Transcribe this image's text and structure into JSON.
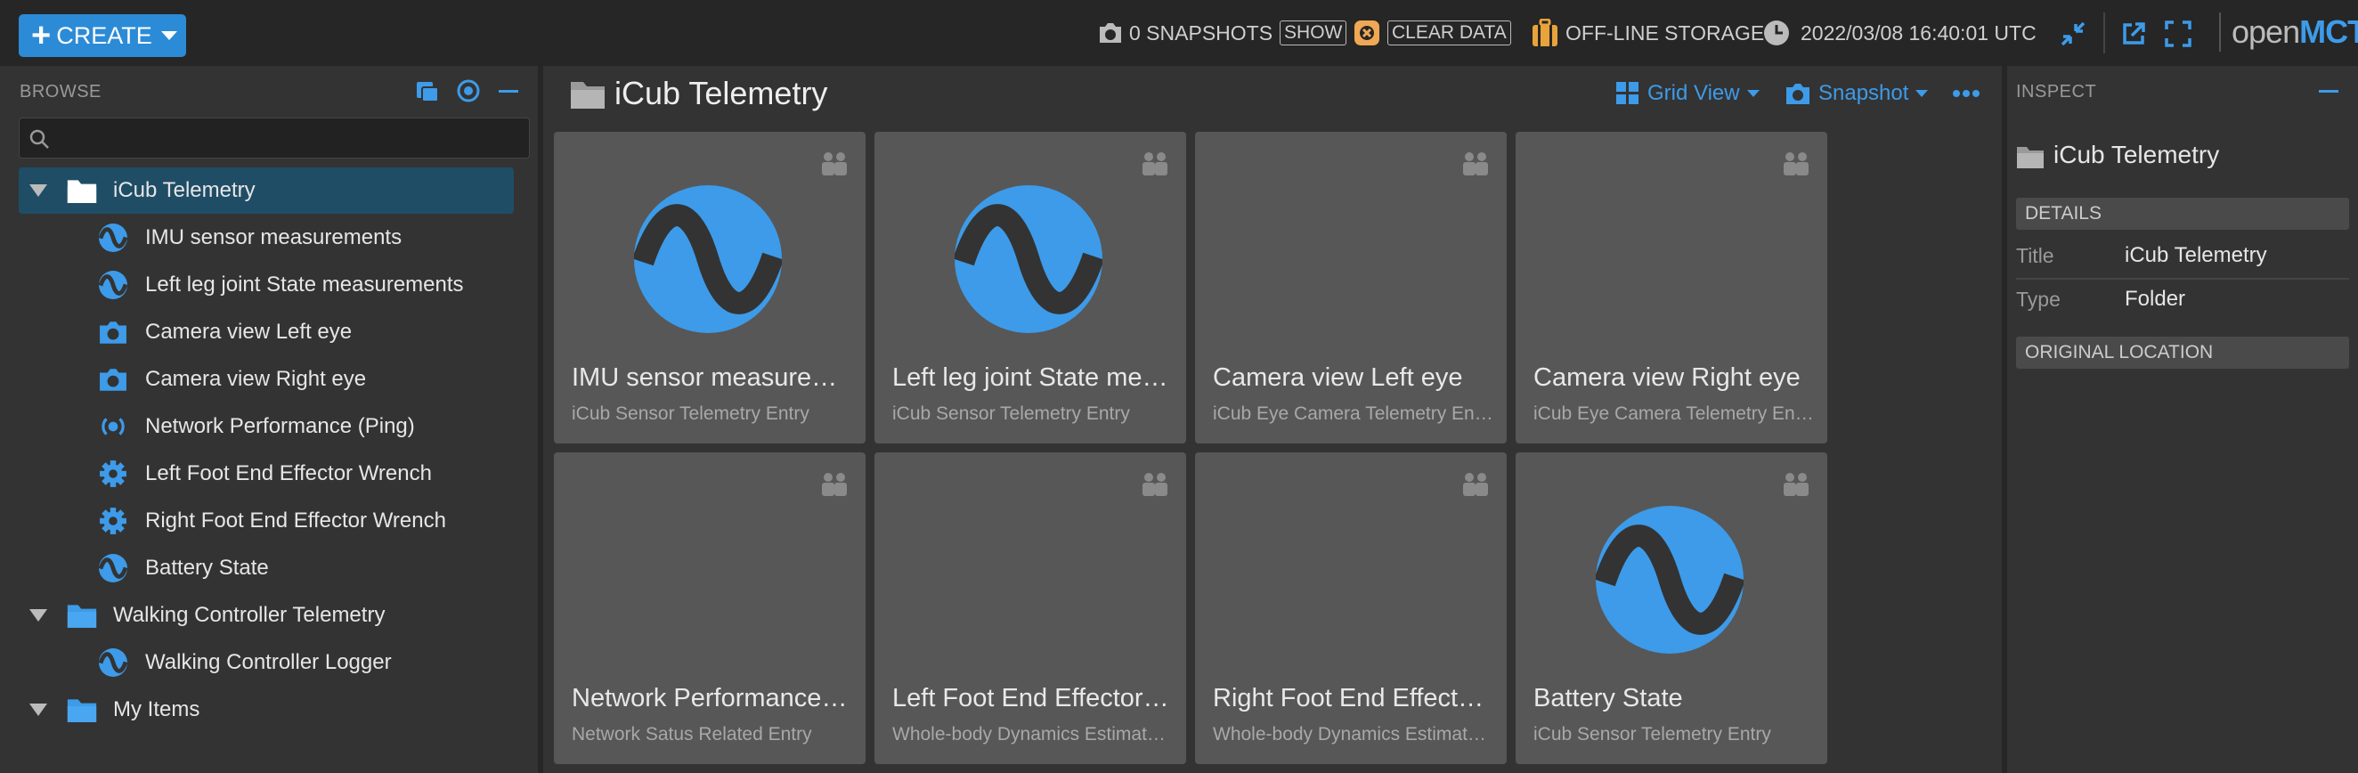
{
  "topbar": {
    "create_label": "CREATE",
    "snapshots_label": "0 SNAPSHOTS",
    "show_label": "SHOW",
    "clear_data_label": "CLEAR DATA",
    "offline_storage_label": "OFF-LINE STORAGE",
    "clock": "2022/03/08 16:40:01 UTC",
    "brand_open": "open",
    "brand_mct": "MCT"
  },
  "browse": {
    "label": "BROWSE",
    "search_placeholder": "",
    "tree": [
      {
        "label": "iCub Telemetry",
        "icon": "folder-icon",
        "level": 0,
        "expanded": true,
        "selected": true
      },
      {
        "label": "IMU sensor measurements",
        "icon": "telemetry-icon",
        "level": 1
      },
      {
        "label": "Left leg joint State measurements",
        "icon": "telemetry-icon",
        "level": 1
      },
      {
        "label": "Camera view Left eye",
        "icon": "camera-icon",
        "level": 1
      },
      {
        "label": "Camera view Right eye",
        "icon": "camera-icon",
        "level": 1
      },
      {
        "label": "Network Performance (Ping)",
        "icon": "network-icon",
        "level": 1
      },
      {
        "label": "Left Foot End Effector Wrench",
        "icon": "gear-icon",
        "level": 1
      },
      {
        "label": "Right Foot End Effector Wrench",
        "icon": "gear-icon",
        "level": 1
      },
      {
        "label": "Battery State",
        "icon": "telemetry-icon",
        "level": 1
      },
      {
        "label": "Walking Controller Telemetry",
        "icon": "folder-icon",
        "level": 0,
        "expanded": true
      },
      {
        "label": "Walking Controller Logger",
        "icon": "telemetry-icon",
        "level": 1
      },
      {
        "label": "My Items",
        "icon": "folder-icon",
        "level": 0,
        "expanded": true
      }
    ]
  },
  "main": {
    "title": "iCub Telemetry",
    "view_label": "Grid View",
    "snapshot_label": "Snapshot",
    "cards": [
      {
        "name": "IMU sensor measurements",
        "sub": "iCub Sensor Telemetry Entry",
        "icon": "telemetry-icon"
      },
      {
        "name": "Left leg joint State measurements",
        "sub": "iCub Sensor Telemetry Entry",
        "icon": "telemetry-icon"
      },
      {
        "name": "Camera view Left eye",
        "sub": "iCub Eye Camera Telemetry Entry",
        "icon": ""
      },
      {
        "name": "Camera view Right eye",
        "sub": "iCub Eye Camera Telemetry Entry",
        "icon": ""
      },
      {
        "name": "Network Performance (Ping)",
        "sub": "Network Satus Related Entry",
        "icon": ""
      },
      {
        "name": "Left Foot End Effector Wrench",
        "sub": "Whole-body Dynamics Estimator Entry",
        "icon": ""
      },
      {
        "name": "Right Foot End Effector Wrench",
        "sub": "Whole-body Dynamics Estimator Entry",
        "icon": ""
      },
      {
        "name": "Battery State",
        "sub": "iCub Sensor Telemetry Entry",
        "icon": "telemetry-icon"
      }
    ]
  },
  "inspector": {
    "label": "INSPECT",
    "object_name": "iCub Telemetry",
    "details_label": "DETAILS",
    "title_key": "Title",
    "title_value": "iCub Telemetry",
    "type_key": "Type",
    "type_value": "Folder",
    "original_location_label": "ORIGINAL LOCATION"
  },
  "colors": {
    "accent": "#3d9be9",
    "create_button": "#2c8bd6",
    "selected_row": "#1f4d66",
    "card_bg": "#575757",
    "clear_data_icon": "#f0a854",
    "storage_icon": "#e8a33b"
  }
}
